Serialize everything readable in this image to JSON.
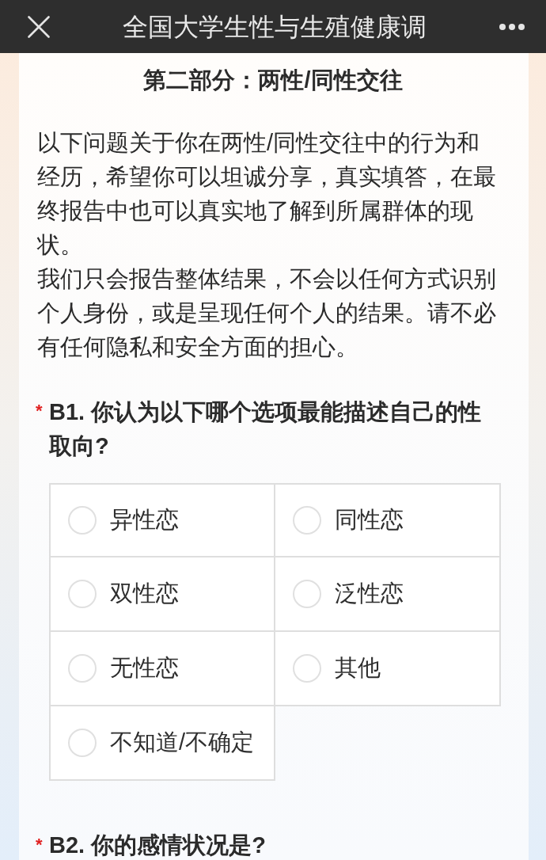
{
  "header": {
    "title": "全国大学生性与生殖健康调"
  },
  "section": {
    "title": "第二部分：两性/同性交往",
    "paragraphs": [
      "以下问题关于你在两性/同性交往中的行为和经历，希望你可以坦诚分享，真实填答，在最终报告中也可以真实地了解到所属群体的现状。",
      "我们只会报告整体结果，不会以任何方式识别个人身份，或是呈现任何个人的结果。请不必有任何隐私和安全方面的担心。"
    ]
  },
  "questions": [
    {
      "required_mark": "*",
      "title": "B1. 你认为以下哪个选项最能描述自己的性取向?",
      "options": [
        {
          "label": "异性恋",
          "selected": false
        },
        {
          "label": "同性恋",
          "selected": false
        },
        {
          "label": "双性恋",
          "selected": false
        },
        {
          "label": "泛性恋",
          "selected": false
        },
        {
          "label": "无性恋",
          "selected": false
        },
        {
          "label": "其他",
          "selected": false
        },
        {
          "label": "不知道/不确定",
          "selected": false
        }
      ]
    },
    {
      "required_mark": "*",
      "title": "B2. 你的感情状况是?"
    }
  ]
}
